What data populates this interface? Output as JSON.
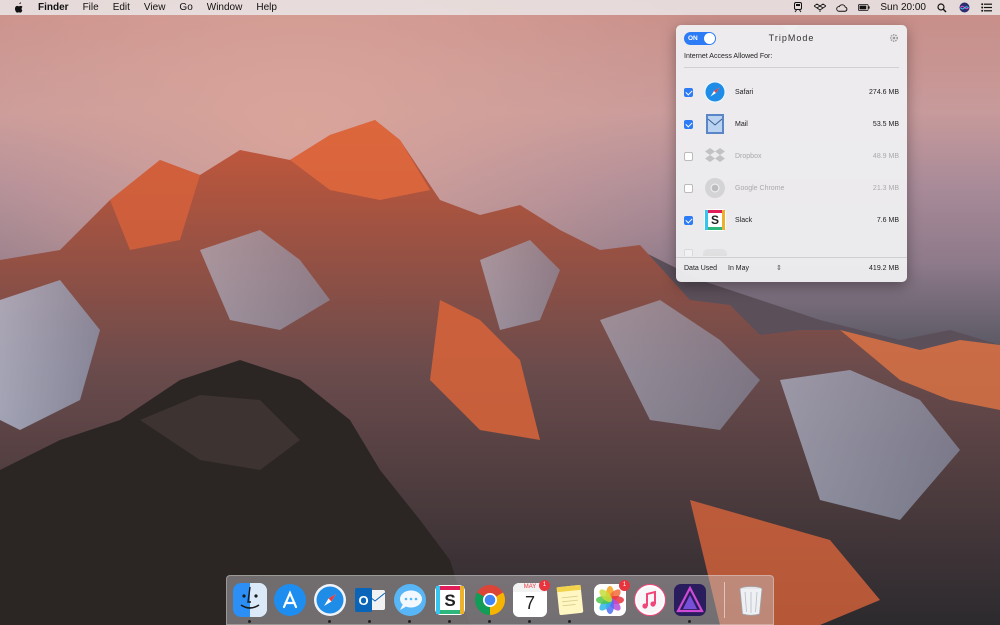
{
  "menubar": {
    "app": "Finder",
    "items": [
      "File",
      "Edit",
      "View",
      "Go",
      "Window",
      "Help"
    ],
    "clock": "Sun 20:00"
  },
  "tripmode": {
    "toggle": "ON",
    "title": "TripMode",
    "subtitle": "Internet Access Allowed For:",
    "apps": [
      {
        "name": "Safari",
        "size": "274.6 MB",
        "checked": true,
        "icon": "safari-icon"
      },
      {
        "name": "Mail",
        "size": "53.5 MB",
        "checked": true,
        "icon": "mail-icon"
      },
      {
        "name": "Dropbox",
        "size": "48.9 MB",
        "checked": false,
        "icon": "dropbox-icon"
      },
      {
        "name": "Google Chrome",
        "size": "21.3 MB",
        "checked": false,
        "icon": "chrome-icon"
      },
      {
        "name": "Slack",
        "size": "7.6 MB",
        "checked": true,
        "icon": "slack-icon"
      }
    ],
    "footer": {
      "label": "Data Used",
      "period": "In May",
      "total": "419.2 MB"
    }
  },
  "dock": {
    "apps": [
      "finder-icon",
      "app-store-icon",
      "safari-icon",
      "outlook-icon",
      "messages-icon",
      "slack-icon",
      "chrome-icon",
      "calendar-icon",
      "notes-icon",
      "photos-icon",
      "itunes-icon",
      "affinity-icon",
      "trash-icon"
    ],
    "calendar_day": "7",
    "calendar_month": "MAY",
    "calendar_badge": "1",
    "photos_badge": "1"
  }
}
